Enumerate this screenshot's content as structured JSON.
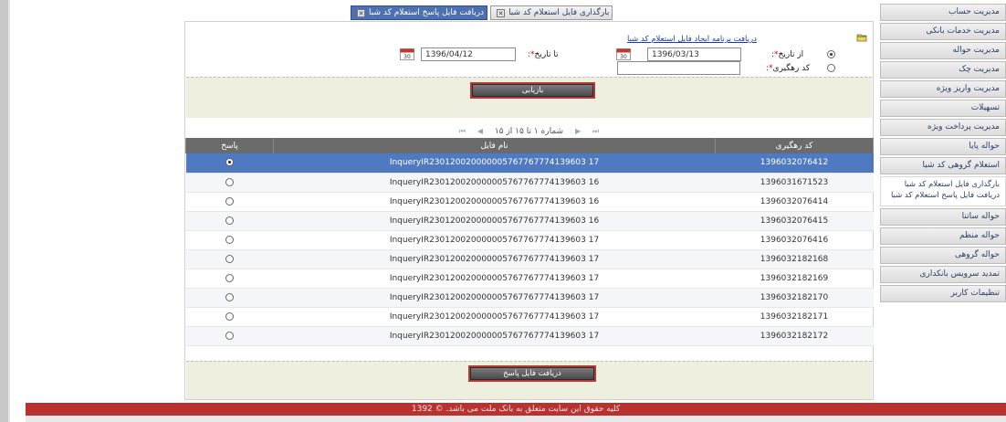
{
  "sidebar": {
    "items": [
      {
        "label": "مدیریت حساب"
      },
      {
        "label": "مدیریت خدمات بانکی"
      },
      {
        "label": "مدیریت حواله"
      },
      {
        "label": "مدیریت چک"
      },
      {
        "label": "مدیریت واریز ویژه"
      },
      {
        "label": "تسهیلات"
      },
      {
        "label": "مدیریت پرداخت ویژه"
      },
      {
        "label": "حواله پایا"
      },
      {
        "label": "استعلام گروهی کد شبا"
      }
    ],
    "subitems": [
      {
        "label": "بارگذاری فایل استعلام کد شبا"
      },
      {
        "label": "دریافت فایل پاسخ استعلام کد شبا"
      }
    ],
    "items_after": [
      {
        "label": "حواله ساتنا"
      },
      {
        "label": "حواله منظم"
      },
      {
        "label": "حواله گروهی"
      },
      {
        "label": "تمدید سرویس بانکداری"
      },
      {
        "label": "تنظیمات کاربر"
      }
    ]
  },
  "tabs": [
    {
      "label": "دریافت فایل پاسخ استعلام کد شبا",
      "active": true
    },
    {
      "label": "بارگذاری فایل استعلام کد شبا",
      "active": false
    }
  ],
  "filter": {
    "download_link": "دریافت برنامه ایجاد فایل استعلام کد شبا",
    "from_date_label": "از تاریخ",
    "from_date_value": "1396/03/13",
    "to_date_label": "تا تاریخ",
    "to_date_value": "1396/04/12",
    "tracking_label": "کد رهگیری",
    "tracking_value": "",
    "required_mark": "*:",
    "search_button": "بازیابی",
    "date_option_selected": true,
    "tracking_option_selected": false
  },
  "pager": {
    "text": "شماره ۱ تا ۱۵ از ۱۵",
    "first": "⏮",
    "prev": "◀",
    "next": "▶",
    "last": "⏭"
  },
  "table": {
    "headers": {
      "response": "پاسخ",
      "file_name": "نام فایل",
      "tracking_code": "کد رهگیری"
    },
    "rows": [
      {
        "file": "InqueryIR230120020000005767767774139603 17",
        "code": "1396032076412",
        "selected": true
      },
      {
        "file": "InqueryIR230120020000005767767774139603 16",
        "code": "1396031671523",
        "selected": false
      },
      {
        "file": "InqueryIR230120020000005767767774139603 16",
        "code": "1396032076414",
        "selected": false
      },
      {
        "file": "InqueryIR230120020000005767767774139603 16",
        "code": "1396032076415",
        "selected": false
      },
      {
        "file": "InqueryIR230120020000005767767774139603 17",
        "code": "1396032076416",
        "selected": false
      },
      {
        "file": "InqueryIR230120020000005767767774139603 17",
        "code": "1396032182168",
        "selected": false
      },
      {
        "file": "InqueryIR230120020000005767767774139603 17",
        "code": "1396032182169",
        "selected": false
      },
      {
        "file": "InqueryIR230120020000005767767774139603 17",
        "code": "1396032182170",
        "selected": false
      },
      {
        "file": "InqueryIR230120020000005767767774139603 17",
        "code": "1396032182171",
        "selected": false
      },
      {
        "file": "InqueryIR230120020000005767767774139603 17",
        "code": "1396032182172",
        "selected": false
      }
    ]
  },
  "download_button": "دریافت فایل پاسخ",
  "footer": "کلیه حقوق این سایت متعلق به بانک ملت می باشد. © 1392",
  "colors": {
    "accent_blue": "#4f7ac1",
    "footer_red": "#b8332f",
    "band_beige": "#efefdf",
    "header_grey": "#6b6b6b"
  },
  "icons": {
    "calendar": "calendar-icon",
    "folder": "folder-icon",
    "tab_close": "close-icon"
  }
}
